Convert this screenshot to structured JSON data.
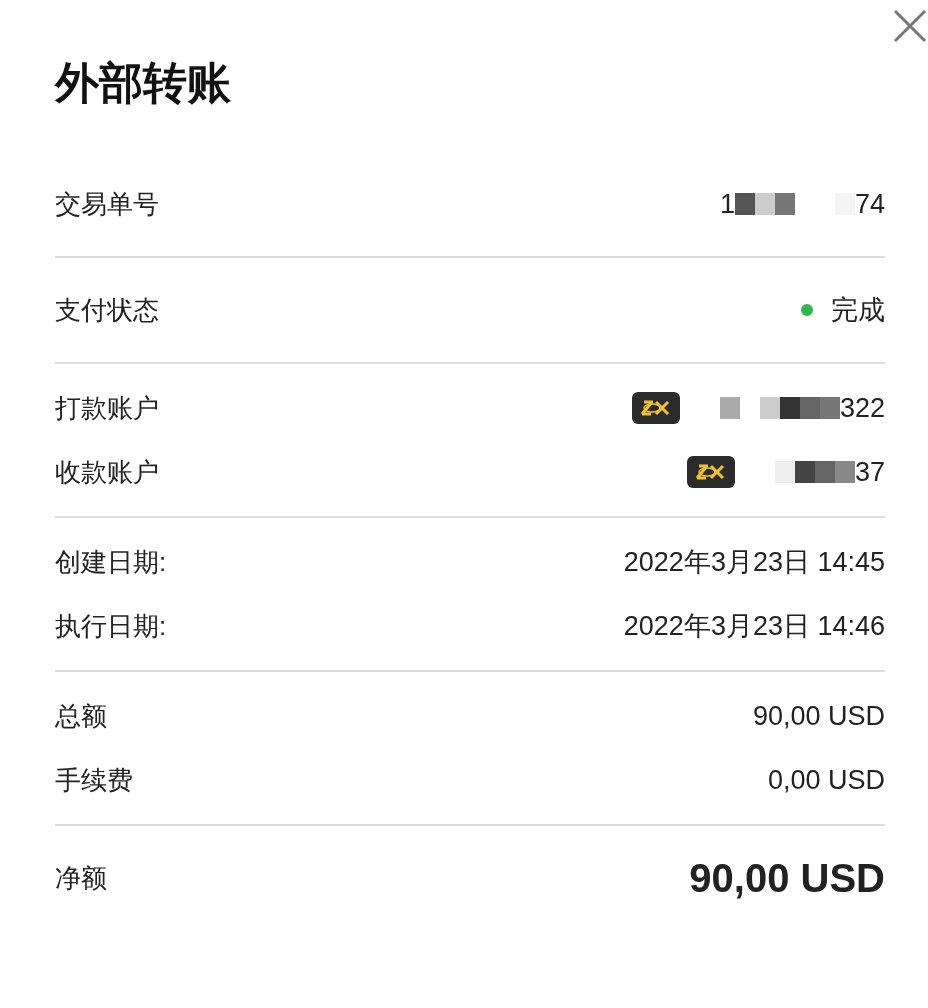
{
  "title": "外部转账",
  "transaction": {
    "label": "交易单号",
    "value_start": "1",
    "value_end": "74"
  },
  "status": {
    "label": "支付状态",
    "value": "完成",
    "color": "#2db84d"
  },
  "payer": {
    "label": "打款账户",
    "value_end": "322"
  },
  "payee": {
    "label": "收款账户",
    "value_end": "37"
  },
  "dates": [
    {
      "label": "创建日期:",
      "value": "2022年3月23日 14:45"
    },
    {
      "label": "执行日期:",
      "value": "2022年3月23日 14:46"
    }
  ],
  "amounts": [
    {
      "label": "总额",
      "value": "90,00 USD"
    },
    {
      "label": "手续费",
      "value": "0,00 USD"
    }
  ],
  "net": {
    "label": "净额",
    "value": "90,00 USD"
  }
}
